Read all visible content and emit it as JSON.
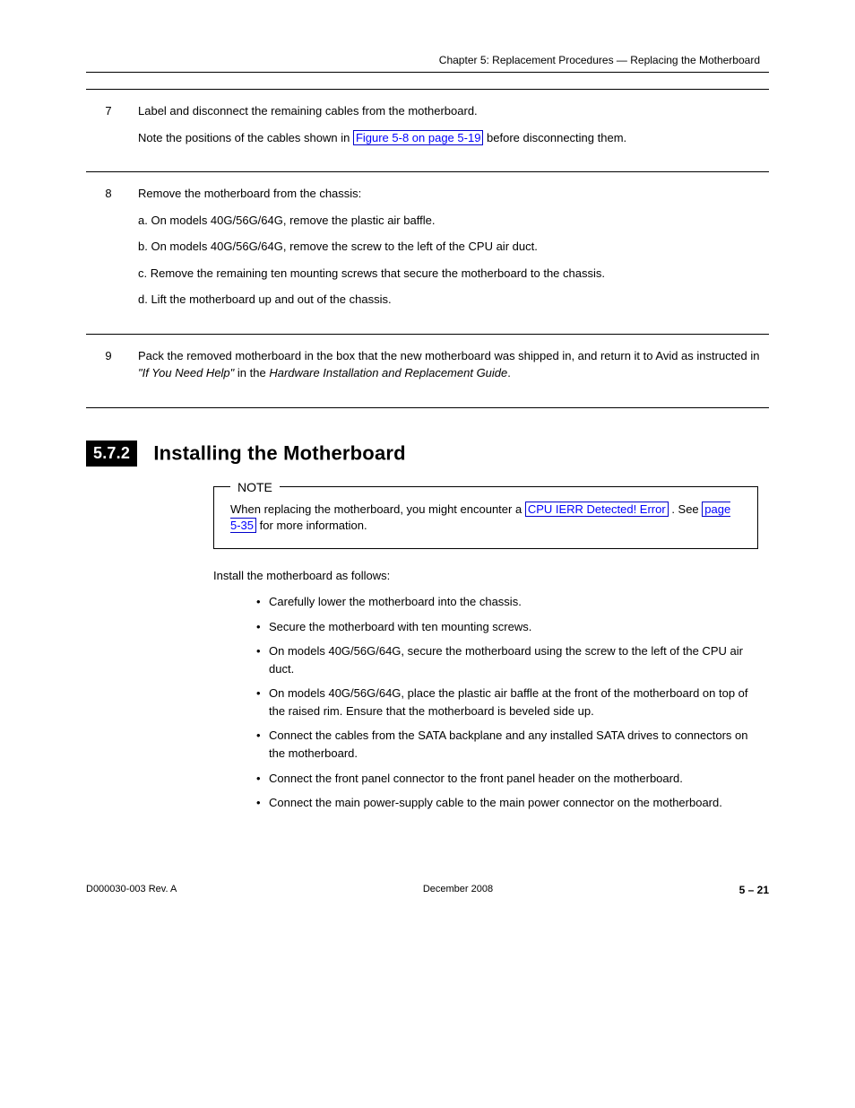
{
  "header": {
    "breadcrumb": "Chapter 5: Replacement Procedures — Replacing the Motherboard"
  },
  "table": {
    "rows": [
      {
        "step": "7",
        "lines": [
          {
            "text": "Label and disconnect the remaining cables from the motherboard.",
            "plain": true
          },
          {
            "prefix": "Note the positions of the cables shown in ",
            "link": "Figure 5-8 on page 5-19",
            "suffix": " before disconnecting them."
          }
        ]
      },
      {
        "step": "8",
        "lines": [
          {
            "text": "Remove the motherboard from the chassis:",
            "plain": true
          },
          {
            "text": "a. On models 40G/56G/64G, remove the plastic air baffle.",
            "plain": true
          },
          {
            "text": "b. On models 40G/56G/64G, remove the screw to the left of the CPU air duct.",
            "plain": true
          },
          {
            "text": "c. Remove the remaining ten mounting screws that secure the motherboard to the chassis.",
            "plain": true
          },
          {
            "text": "d. Lift the motherboard up and out of the chassis.",
            "plain": true
          }
        ]
      },
      {
        "step": "9",
        "lines": [
          {
            "prefix": "Pack the removed motherboard in the box that the new motherboard was shipped in, and return it to Avid as instructed in ",
            "italic": "\"If You Need Help\"",
            "middle": " in the ",
            "italic2": "Hardware Installation and Replacement Guide",
            "suffix2": "."
          }
        ]
      }
    ]
  },
  "section": {
    "tag": "5.7.2",
    "title": "Installing the Motherboard"
  },
  "note": {
    "label": "NOTE",
    "prefix": "When replacing the motherboard, you might encounter a ",
    "link1": "CPU IERR Detected! Error",
    "middle": ". See ",
    "link2": "page 5-35",
    "suffix": " for more information."
  },
  "para": "Install the motherboard as follows:",
  "bullets": [
    "Carefully lower the motherboard into the chassis.",
    "Secure the motherboard with ten mounting screws.",
    "On models 40G/56G/64G, secure the motherboard using the screw to the left of the CPU air duct.",
    "On models 40G/56G/64G, place the plastic air baffle at the front of the motherboard on top of the raised rim. Ensure that the motherboard is beveled side up.",
    "Connect the cables from the SATA backplane and any installed SATA drives to connectors on the motherboard.",
    "Connect the front panel connector to the front panel header on the motherboard.",
    "Connect the main power-supply cable to the main power connector on the motherboard."
  ],
  "footer": {
    "rev": "D000030-003 Rev. A",
    "date": "December 2008",
    "page": "5 – 21"
  }
}
